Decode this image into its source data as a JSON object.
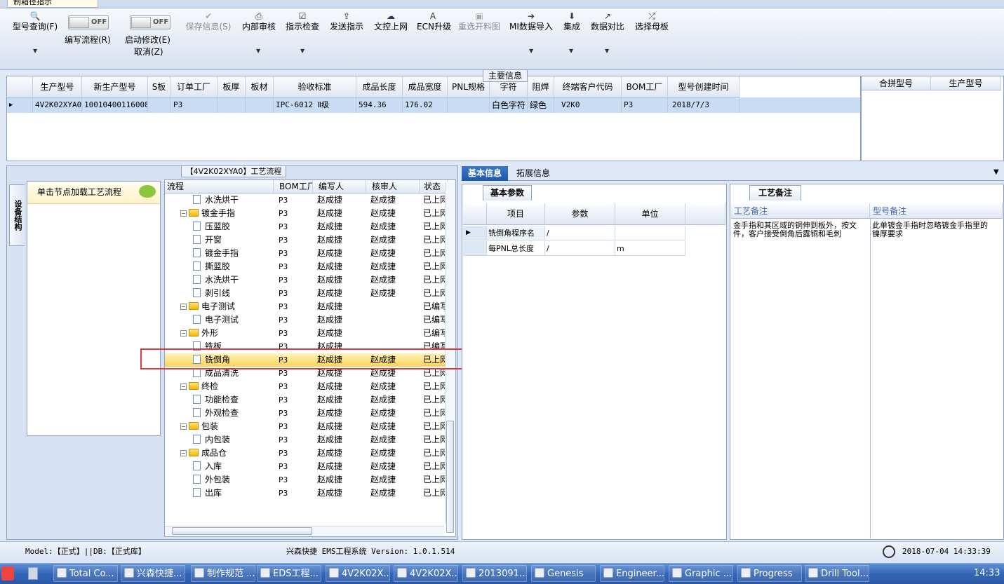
{
  "window": {
    "doc_tab": "制箱径指示"
  },
  "ribbon": {
    "toggle_off": "OFF",
    "buttons": [
      {
        "label": "型号查询(F)",
        "icon": "🔍"
      },
      {
        "label": "保存信息(S)",
        "icon": "✔"
      },
      {
        "label": "内部审核",
        "icon": "⎙"
      },
      {
        "label": "指示检查",
        "icon": "☑"
      },
      {
        "label": "发送指示",
        "icon": "⇪"
      },
      {
        "label": "文控上网",
        "icon": "☁"
      },
      {
        "label": "ECN升级",
        "icon": "A"
      },
      {
        "label": "重选开料图",
        "icon": "▣"
      },
      {
        "label": "MI数据导入",
        "icon": "➔"
      },
      {
        "label": "集成",
        "icon": "⬇"
      },
      {
        "label": "数据对比",
        "icon": "↗"
      },
      {
        "label": "选择母板",
        "icon": "⤮"
      }
    ],
    "toggle1_label": "编写流程(R)",
    "toggle2_label": "启动修改(E)",
    "toggle2_sub": "取消(Z)"
  },
  "main_info": {
    "title": "主要信息",
    "columns": [
      "生产型号",
      "新生产型号",
      "S板",
      "订单工厂",
      "板厚",
      "板材",
      "验收标准",
      "成品长度",
      "成品宽度",
      "PNL规格",
      "字符",
      "阻焊",
      "终端客户代码",
      "BOM工厂",
      "型号创建时间"
    ],
    "row": [
      "4V2K02XYA0",
      "10010400116008",
      "",
      "P3",
      "",
      "",
      "IPC-6012 Ⅱ级",
      "594.36",
      "176.02",
      "",
      "白色字符",
      "绿色",
      "V2K0",
      "P3",
      "2018/7/3"
    ],
    "side_columns": [
      "合拼型号",
      "生产型号"
    ]
  },
  "left": {
    "vtab": "设备结构",
    "load_label": "单击节点加载工艺流程",
    "flow_title": "【4V2K02XYA0】工艺流程",
    "tree_columns": [
      "流程",
      "BOM工厂",
      "编写人",
      "核审人",
      "状态"
    ],
    "tree_rows": [
      {
        "name": "水洗烘干",
        "bom": "P3",
        "writer": "赵成捷",
        "reviewer": "赵成捷",
        "status": "已上网",
        "level": 2
      },
      {
        "name": "镀金手指",
        "bom": "P3",
        "writer": "赵成捷",
        "reviewer": "赵成捷",
        "status": "已上网",
        "level": 1
      },
      {
        "name": "压蓝胶",
        "bom": "P3",
        "writer": "赵成捷",
        "reviewer": "赵成捷",
        "status": "已上网",
        "level": 2
      },
      {
        "name": "开窗",
        "bom": "P3",
        "writer": "赵成捷",
        "reviewer": "赵成捷",
        "status": "已上网",
        "level": 2
      },
      {
        "name": "镀金手指",
        "bom": "P3",
        "writer": "赵成捷",
        "reviewer": "赵成捷",
        "status": "已上网",
        "level": 2
      },
      {
        "name": "撕蓝胶",
        "bom": "P3",
        "writer": "赵成捷",
        "reviewer": "赵成捷",
        "status": "已上网",
        "level": 2
      },
      {
        "name": "水洗烘干",
        "bom": "P3",
        "writer": "赵成捷",
        "reviewer": "赵成捷",
        "status": "已上网",
        "level": 2
      },
      {
        "name": "剥引线",
        "bom": "P3",
        "writer": "赵成捷",
        "reviewer": "赵成捷",
        "status": "已上网",
        "level": 2
      },
      {
        "name": "电子测试",
        "bom": "P3",
        "writer": "赵成捷",
        "reviewer": "",
        "status": "已编写",
        "level": 1
      },
      {
        "name": "电子测试",
        "bom": "P3",
        "writer": "赵成捷",
        "reviewer": "",
        "status": "已编写",
        "level": 2
      },
      {
        "name": "外形",
        "bom": "P3",
        "writer": "赵成捷",
        "reviewer": "",
        "status": "已编写",
        "level": 1
      },
      {
        "name": "铣板",
        "bom": "P3",
        "writer": "赵成捷",
        "reviewer": "",
        "status": "已编写",
        "level": 2
      },
      {
        "name": "铣倒角",
        "bom": "P3",
        "writer": "赵成捷",
        "reviewer": "赵成捷",
        "status": "已上网",
        "level": 2
      },
      {
        "name": "成品清洗",
        "bom": "P3",
        "writer": "赵成捷",
        "reviewer": "赵成捷",
        "status": "已上网",
        "level": 2
      },
      {
        "name": "终检",
        "bom": "P3",
        "writer": "赵成捷",
        "reviewer": "赵成捷",
        "status": "已上网",
        "level": 1
      },
      {
        "name": "功能检查",
        "bom": "P3",
        "writer": "赵成捷",
        "reviewer": "赵成捷",
        "status": "已上网",
        "level": 2
      },
      {
        "name": "外观检查",
        "bom": "P3",
        "writer": "赵成捷",
        "reviewer": "赵成捷",
        "status": "已上网",
        "level": 2
      },
      {
        "name": "包装",
        "bom": "P3",
        "writer": "赵成捷",
        "reviewer": "赵成捷",
        "status": "已上网",
        "level": 1
      },
      {
        "name": "内包装",
        "bom": "P3",
        "writer": "赵成捷",
        "reviewer": "赵成捷",
        "status": "已上网",
        "level": 2
      },
      {
        "name": "成品仓",
        "bom": "P3",
        "writer": "赵成捷",
        "reviewer": "赵成捷",
        "status": "已上网",
        "level": 1
      },
      {
        "name": "入库",
        "bom": "P3",
        "writer": "赵成捷",
        "reviewer": "赵成捷",
        "status": "已上网",
        "level": 2
      },
      {
        "name": "外包装",
        "bom": "P3",
        "writer": "赵成捷",
        "reviewer": "赵成捷",
        "status": "已上网",
        "level": 2
      },
      {
        "name": "出库",
        "bom": "P3",
        "writer": "赵成捷",
        "reviewer": "赵成捷",
        "status": "已上网",
        "level": 2
      }
    ]
  },
  "right": {
    "tabs": [
      "基本信息",
      "拓展信息"
    ],
    "param_tab": "基本参数",
    "param_columns": [
      "项目",
      "参数",
      "单位"
    ],
    "param_rows": [
      [
        "铣倒角程序名",
        "/",
        ""
      ],
      [
        "每PNL总长度",
        "/",
        "m"
      ]
    ],
    "note_tab": "工艺备注",
    "note_columns": [
      "工艺备注",
      "型号备注"
    ],
    "process_note": "金手指和其区域的铜伸到板外，按文件，客户接受倒角后露铜和毛刺",
    "model_note": "此单镀金手指时忽略镀金手指里的镍厚要求"
  },
  "status": {
    "model": "Model:【正式】||DB:【正式库】",
    "system": "兴森快捷 EMS工程系统 Version: 1.0.1.514",
    "time": "2018-07-04 14:33:39"
  },
  "taskbar": {
    "items": [
      "Total Co...",
      "兴森快捷...",
      "制作规范 ...",
      "EDS工程...",
      "4V2K02X...",
      "4V2K02X...",
      "2013091...",
      "Genesis",
      "Engineer...",
      "Graphic ...",
      "Progress",
      "Drill Tool..."
    ],
    "clock": "14:33"
  }
}
